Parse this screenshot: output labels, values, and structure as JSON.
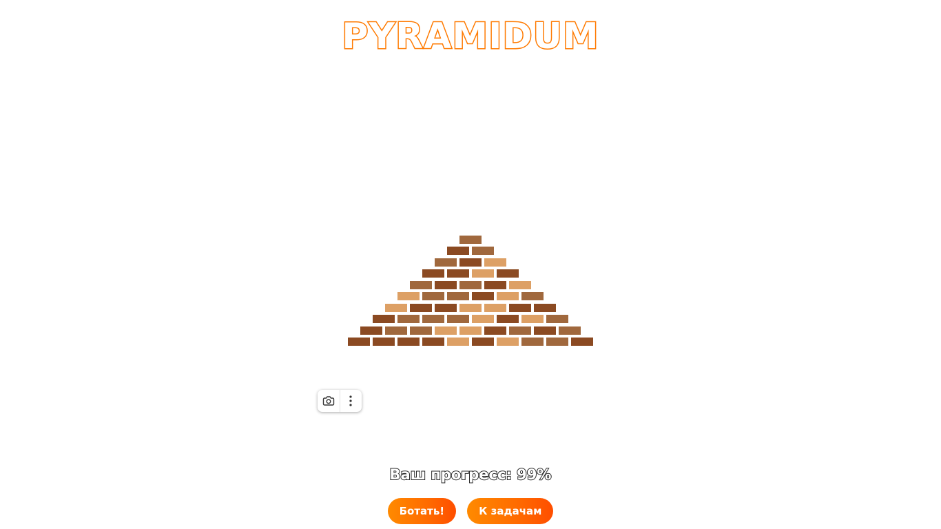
{
  "header": {
    "logo_text": "PYRAMIDUM"
  },
  "pyramid": {
    "rows": 10,
    "brick_colors": [
      "#8b4a22",
      "#a0683d",
      "#dda065"
    ]
  },
  "toolbar": {
    "screenshot_icon": "camera-icon",
    "more_icon": "more-vertical-icon"
  },
  "progress": {
    "label": "Ваш прогресс: 99%",
    "percent": 99
  },
  "actions": {
    "primary_label": "Ботать!",
    "tasks_label": "К задачам"
  },
  "colors": {
    "accent": "#ff7a00",
    "button_gradient_start": "#ff8a00",
    "button_gradient_end": "#ff4e00"
  }
}
